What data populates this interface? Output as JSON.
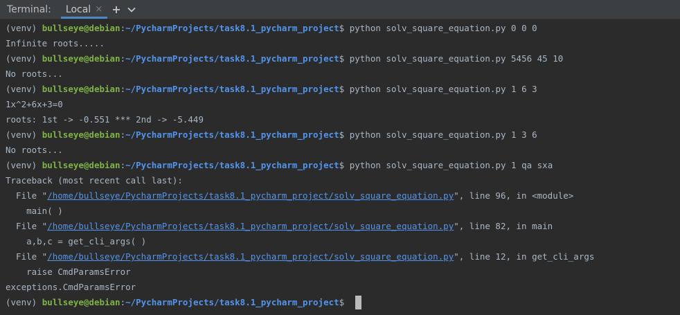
{
  "tabbar": {
    "title": "Terminal:",
    "tab_label": "Local",
    "close_glyph": "×",
    "add_glyph": "+",
    "dropdown_icon": "chevron-down-icon"
  },
  "prompt": {
    "venv": "(venv) ",
    "user_host": "bullseye@debian",
    "colon": ":",
    "path": "~/PycharmProjects/task8.1_pycharm_project",
    "dollar": "$ "
  },
  "lines": [
    {
      "kind": "prompt",
      "cmd": "python solv_square_equation.py 0 0 0"
    },
    {
      "kind": "out",
      "text": "Infinite roots....."
    },
    {
      "kind": "prompt",
      "cmd": "python solv_square_equation.py 5456 45 10"
    },
    {
      "kind": "out",
      "text": "No roots..."
    },
    {
      "kind": "prompt",
      "cmd": "python solv_square_equation.py 1 6 3"
    },
    {
      "kind": "out",
      "text": "1x^2+6x+3=0"
    },
    {
      "kind": "out",
      "text": "roots: 1st -> -0.551 *** 2nd -> -5.449"
    },
    {
      "kind": "prompt",
      "cmd": "python solv_square_equation.py 1 3 6"
    },
    {
      "kind": "out",
      "text": "No roots..."
    },
    {
      "kind": "prompt",
      "cmd": "python solv_square_equation.py 1 qa sxa"
    },
    {
      "kind": "out",
      "text": "Traceback (most recent call last):"
    },
    {
      "kind": "file",
      "pre": "  File \"",
      "link": "/home/bullseye/PycharmProjects/task8.1_pycharm_project/solv_square_equation.py",
      "post": "\", line 96, in <module>"
    },
    {
      "kind": "out",
      "text": "    main( )"
    },
    {
      "kind": "file",
      "pre": "  File \"",
      "link": "/home/bullseye/PycharmProjects/task8.1_pycharm_project/solv_square_equation.py",
      "post": "\", line 82, in main"
    },
    {
      "kind": "out",
      "text": "    a,b,c = get_cli_args( )"
    },
    {
      "kind": "file",
      "pre": "  File \"",
      "link": "/home/bullseye/PycharmProjects/task8.1_pycharm_project/solv_square_equation.py",
      "post": "\", line 12, in get_cli_args"
    },
    {
      "kind": "out",
      "text": "    raise CmdParamsError"
    },
    {
      "kind": "out",
      "text": "exceptions.CmdParamsError"
    },
    {
      "kind": "prompt",
      "cmd": "",
      "cursor": true
    }
  ],
  "colors": {
    "background": "#2b2b2b",
    "user_host": "#7fb347",
    "path": "#5394ec",
    "text": "#a9b7c6",
    "tab_underline": "#4a88c7"
  }
}
